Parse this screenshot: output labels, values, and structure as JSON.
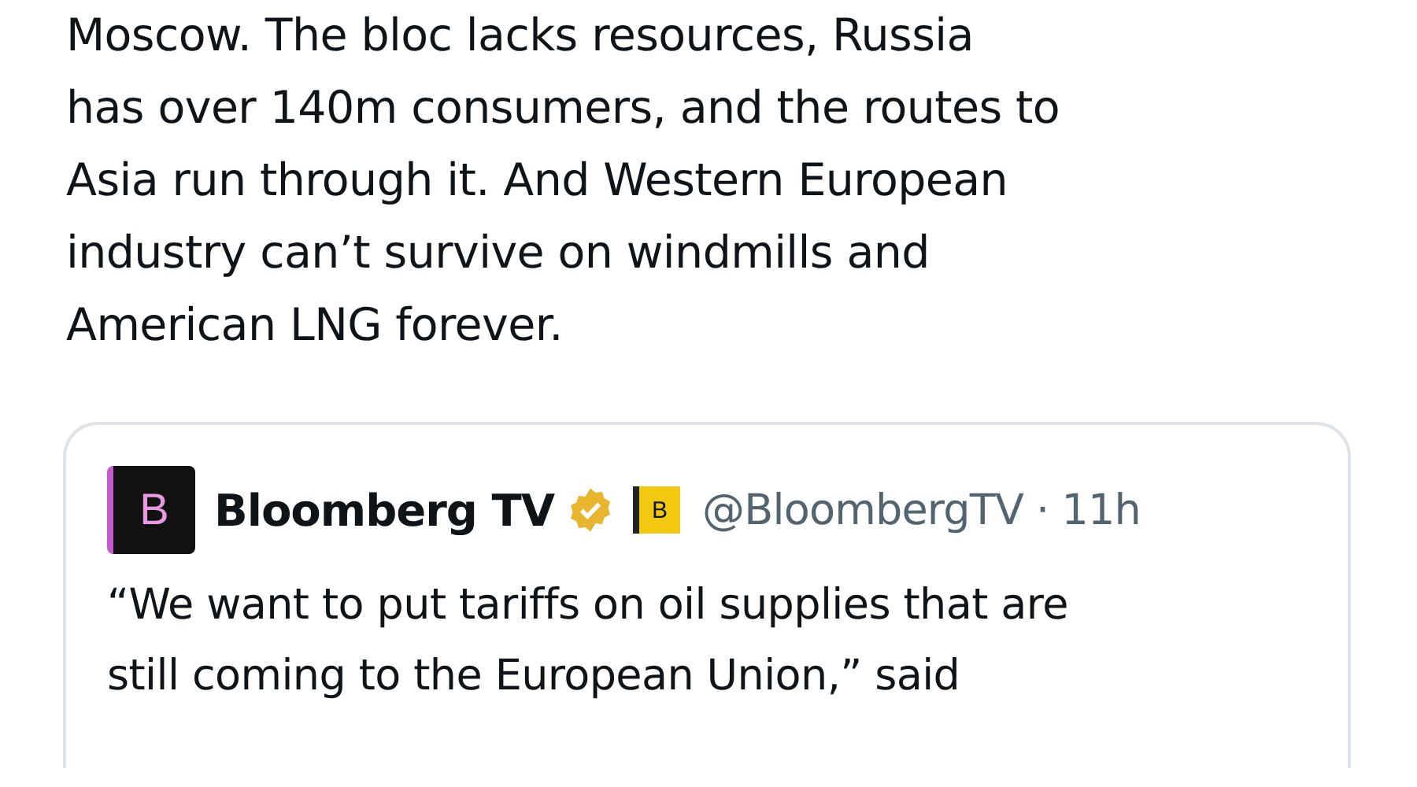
{
  "post": {
    "text": "Moscow. The bloc lacks resources, Russia\nhas over 140m consumers, and the routes to\nAsia run through it. And Western European\nindustry can’t survive on windmills and\nAmerican LNG forever."
  },
  "quoted_post": {
    "avatar_letter": "B",
    "name": "Bloomberg TV",
    "verified": true,
    "affiliate_letter": "B",
    "handle": "@BloombergTV",
    "separator": "·",
    "time": "11h",
    "text": "“We want to put tariffs on oil supplies that are\nstill coming to the European Union,” said"
  }
}
